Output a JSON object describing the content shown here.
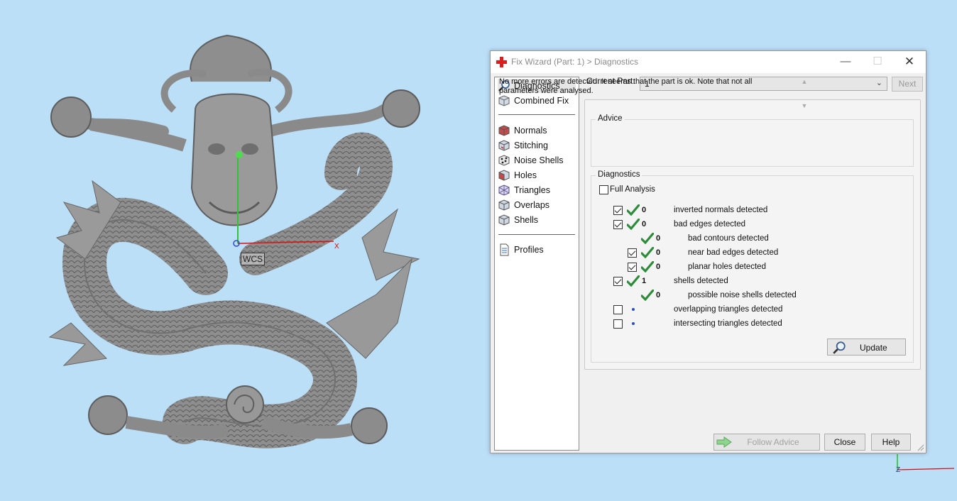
{
  "viewport": {
    "background": "#bcdff8",
    "wcs_label": "WCS",
    "axis_x_label": "X",
    "corner_axis_label": "Z"
  },
  "dialog": {
    "title": "Fix Wizard (Part: 1) > Diagnostics",
    "controls": {
      "minimize": "—",
      "maximize": "☐",
      "close": "✕"
    },
    "sidebar": {
      "items_top": [
        {
          "label": "Diagnostics",
          "icon": "magnifier-icon",
          "selected": true
        },
        {
          "label": "Combined Fix",
          "icon": "cube-icon"
        }
      ],
      "items_mid": [
        {
          "label": "Normals",
          "icon": "normals-cube-icon"
        },
        {
          "label": "Stitching",
          "icon": "stitching-cube-icon"
        },
        {
          "label": "Noise Shells",
          "icon": "noise-shells-icon"
        },
        {
          "label": "Holes",
          "icon": "holes-cube-icon"
        },
        {
          "label": "Triangles",
          "icon": "triangles-icon"
        },
        {
          "label": "Overlaps",
          "icon": "overlaps-cube-icon"
        },
        {
          "label": "Shells",
          "icon": "shells-cube-icon"
        }
      ],
      "items_bottom": [
        {
          "label": "Profiles",
          "icon": "document-icon"
        }
      ]
    },
    "current_part": {
      "label": "Current Part:",
      "value": "1"
    },
    "next_label": "Next",
    "advice": {
      "legend": "Advice",
      "line1": "No more errors are detected. It seems that the part is ok. Note that not all",
      "line2": "parameters were analysed."
    },
    "diagnostics": {
      "legend": "Diagnostics",
      "full_analysis": {
        "label": "Full Analysis",
        "checked": false
      },
      "rows": [
        {
          "checked": true,
          "status": "ok",
          "count": "0",
          "label": "inverted normals detected"
        },
        {
          "checked": true,
          "status": "ok",
          "count": "0",
          "label": "bad edges detected"
        },
        {
          "checked": null,
          "status": "ok",
          "count": "0",
          "label": "bad contours detected"
        },
        {
          "checked": true,
          "status": "ok",
          "count": "0",
          "label": "near bad edges detected"
        },
        {
          "checked": true,
          "status": "ok",
          "count": "0",
          "label": "planar holes detected"
        },
        {
          "checked": true,
          "status": "ok",
          "count": "1",
          "label": "shells detected"
        },
        {
          "checked": null,
          "status": "ok",
          "count": "0",
          "label": "possible noise shells detected"
        },
        {
          "checked": false,
          "status": "pending",
          "count": "",
          "label": "overlapping triangles detected"
        },
        {
          "checked": false,
          "status": "pending",
          "count": "",
          "label": "intersecting triangles detected"
        }
      ],
      "update_label": "Update"
    },
    "buttons": {
      "follow_advice": "Follow Advice",
      "close": "Close",
      "help": "Help"
    },
    "colors": {
      "ok_check": "#2e8b3a",
      "pending_dot": "#2a4fb8",
      "app_icon": "#d81e1e"
    }
  }
}
